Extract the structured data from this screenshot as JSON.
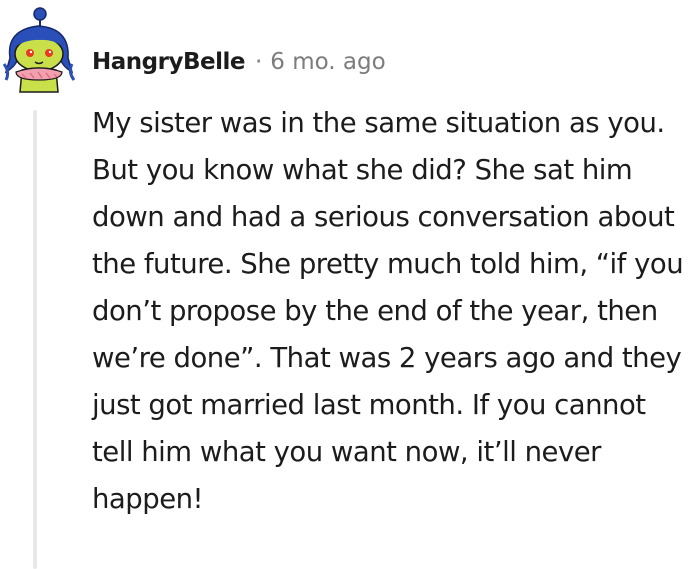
{
  "comment": {
    "username": "HangryBelle",
    "separator": "·",
    "timestamp": "6 mo. ago",
    "body": "My sister was in the same situation as you. But you know what she did? She sat him down and had a serious conversation about the future. She pretty much told him, “if you don’t propose by the end of the year, then we’re done”. That was 2 years ago and they just got married last month. If you cannot tell him what you want now, it’ll never happen!"
  },
  "colors": {
    "text": "#1c1c1c",
    "meta": "#7c7c7c",
    "thread_line": "#e8e8e8",
    "avatar_hair": "#2a4fb8",
    "avatar_skin": "#c9e04a",
    "avatar_eyes": "#e83a1e"
  },
  "icons": {
    "avatar": "snoo-avatar-icon"
  }
}
